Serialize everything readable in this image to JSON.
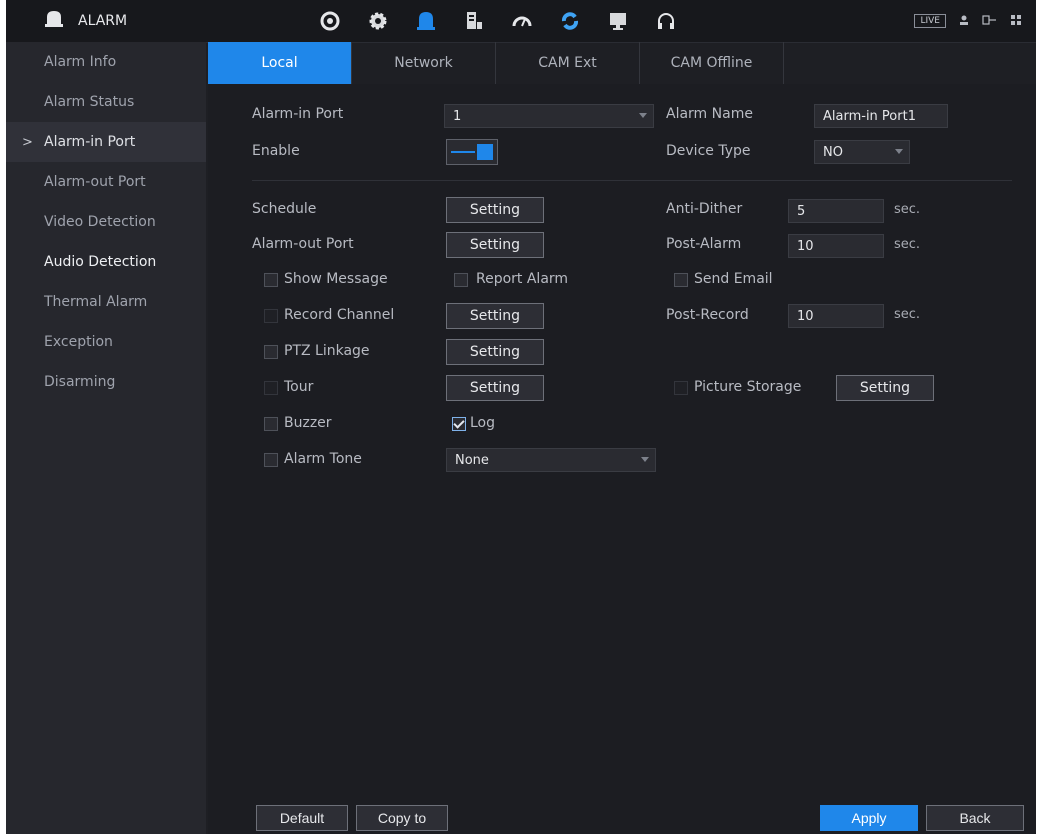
{
  "app": {
    "title": "ALARM",
    "live_label": "LIVE"
  },
  "top_icons": [
    "search-icon",
    "gear-icon",
    "alarm-bell-icon",
    "storage-icon",
    "gauge-icon",
    "refresh-icon",
    "monitor-icon",
    "headset-icon"
  ],
  "sidebar": {
    "items": [
      {
        "label": "Alarm Info"
      },
      {
        "label": "Alarm Status"
      },
      {
        "label": "Alarm-in Port",
        "active": true
      },
      {
        "label": "Alarm-out Port"
      },
      {
        "label": "Video Detection"
      },
      {
        "label": "Audio Detection"
      },
      {
        "label": "Thermal Alarm"
      },
      {
        "label": "Exception"
      },
      {
        "label": "Disarming"
      }
    ],
    "arrow": ">"
  },
  "tabs": [
    {
      "label": "Local",
      "active": true
    },
    {
      "label": "Network"
    },
    {
      "label": "CAM Ext"
    },
    {
      "label": "CAM Offline"
    }
  ],
  "form": {
    "alarm_in_port_label": "Alarm-in Port",
    "alarm_in_port_value": "1",
    "alarm_name_label": "Alarm Name",
    "alarm_name_value": "Alarm-in Port1",
    "enable_label": "Enable",
    "enable_on": true,
    "device_type_label": "Device Type",
    "device_type_value": "NO",
    "schedule_label": "Schedule",
    "anti_dither_label": "Anti-Dither",
    "anti_dither_value": "5",
    "alarm_out_port_label": "Alarm-out Port",
    "post_alarm_label": "Post-Alarm",
    "post_alarm_value": "10",
    "show_message_label": "Show Message",
    "report_alarm_label": "Report Alarm",
    "send_email_label": "Send Email",
    "record_channel_label": "Record Channel",
    "post_record_label": "Post-Record",
    "post_record_value": "10",
    "ptz_linkage_label": "PTZ Linkage",
    "tour_label": "Tour",
    "picture_storage_label": "Picture Storage",
    "buzzer_label": "Buzzer",
    "log_label": "Log",
    "log_checked": true,
    "alarm_tone_label": "Alarm Tone",
    "alarm_tone_value": "None",
    "sec_unit": "sec.",
    "setting_label": "Setting"
  },
  "bottom": {
    "default_label": "Default",
    "copy_to_label": "Copy to",
    "apply_label": "Apply",
    "back_label": "Back"
  },
  "colors": {
    "accent": "#1f87ea",
    "background": "#1e1f24",
    "sidebar": "#26272d"
  }
}
